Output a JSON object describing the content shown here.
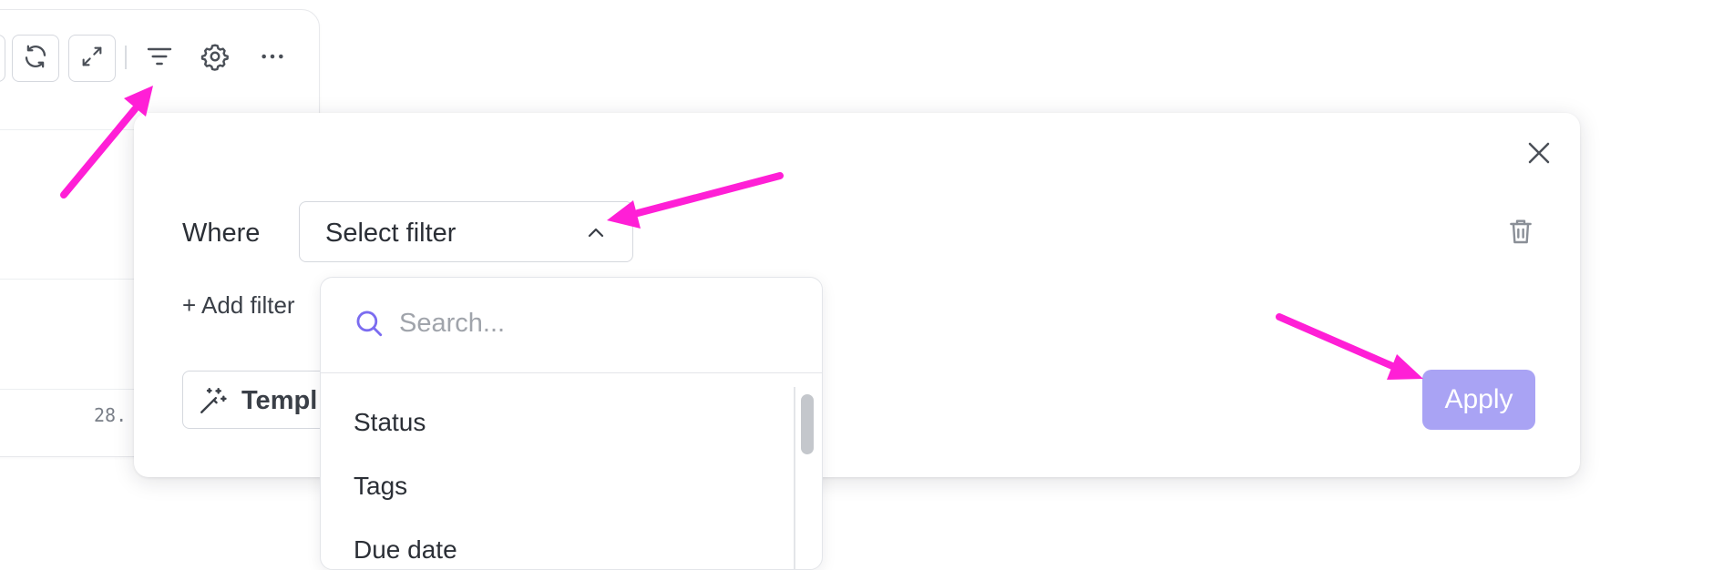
{
  "toolbar": {
    "icons": [
      "refresh-icon",
      "expand-icon",
      "filter-icon",
      "gear-icon",
      "more-icon"
    ]
  },
  "background": {
    "cell_text": "28."
  },
  "filter_panel": {
    "where_label": "Where",
    "select_value": "Select filter",
    "add_filter_label": "+ Add filter",
    "templates_label": "Templ",
    "apply_label": "Apply"
  },
  "dropdown": {
    "search_placeholder": "Search...",
    "items": [
      "Status",
      "Tags",
      "Due date"
    ]
  },
  "colors": {
    "accent": "#a9a3f4",
    "accent_icon": "#7b6cf0",
    "annotation": "#ff1fd6",
    "border": "#d5d8de",
    "text": "#2b2f36"
  }
}
